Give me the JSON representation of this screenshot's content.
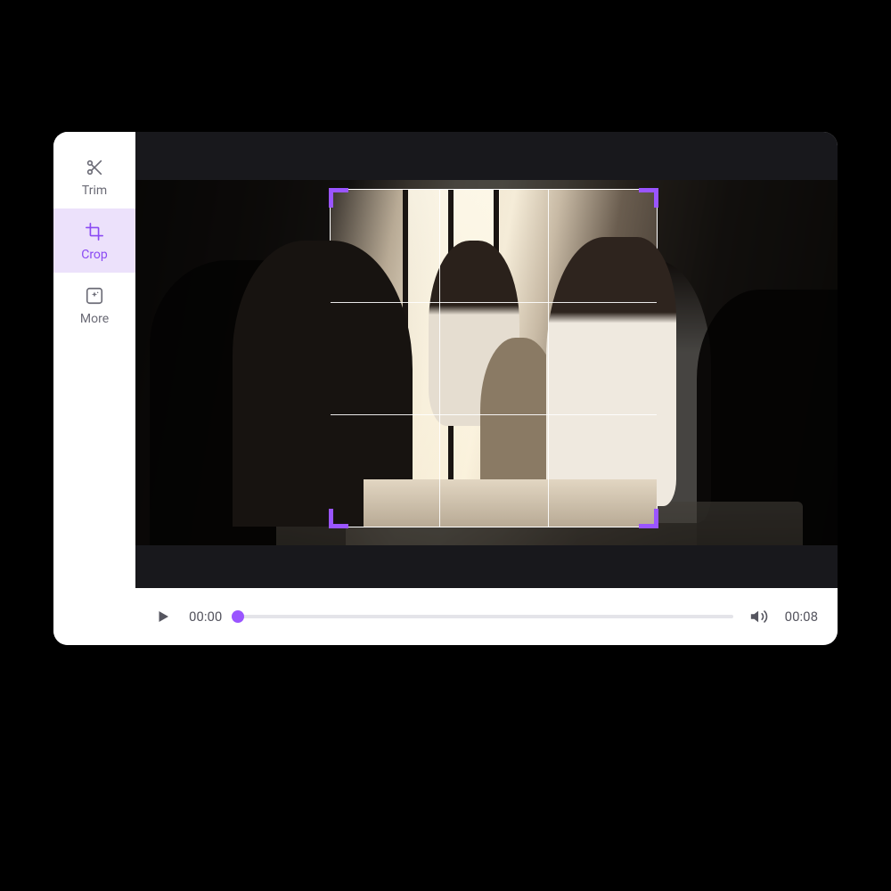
{
  "sidebar": {
    "items": [
      {
        "label": "Trim",
        "icon": "scissors-icon",
        "active": false
      },
      {
        "label": "Crop",
        "icon": "crop-icon",
        "active": true
      },
      {
        "label": "More",
        "icon": "sparkle-icon",
        "active": false
      }
    ]
  },
  "player": {
    "current_time": "00:00",
    "duration": "00:08",
    "progress_percent": 0
  },
  "colors": {
    "accent": "#9a55ff",
    "accent_bg": "#ece1fb"
  }
}
